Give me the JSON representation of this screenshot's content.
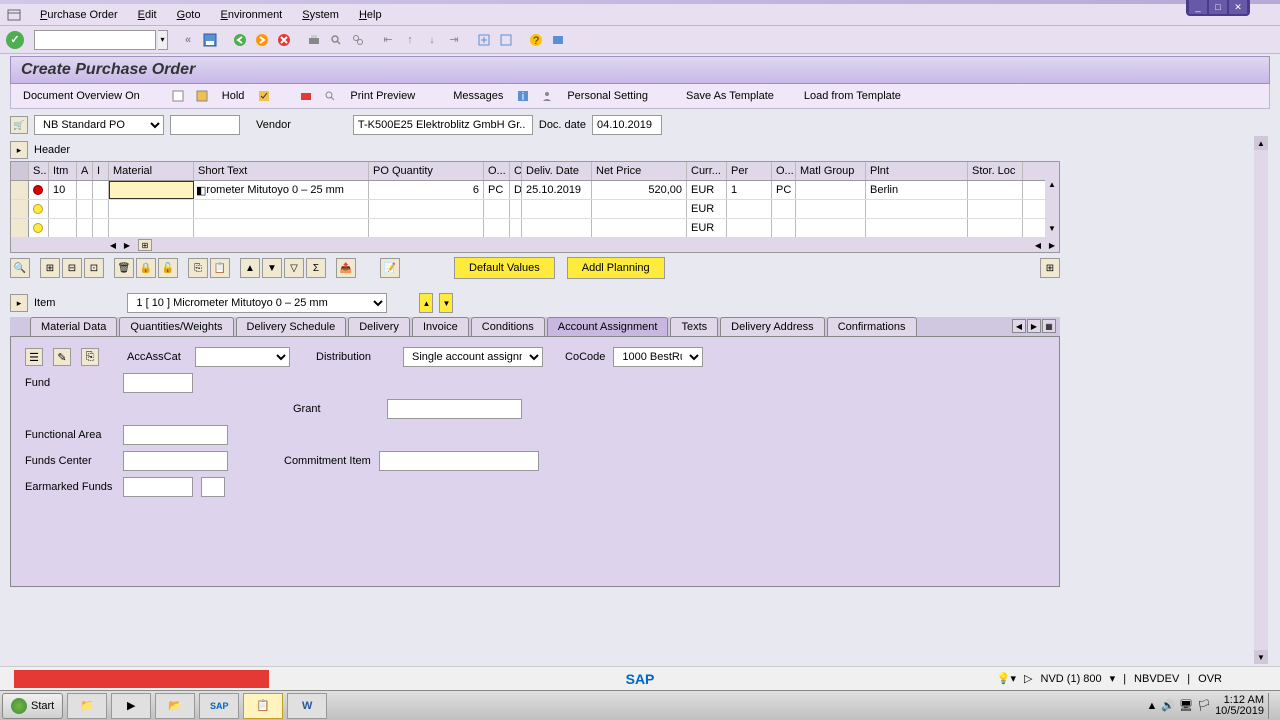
{
  "window": {
    "min": "_",
    "max": "□",
    "close": "✕"
  },
  "menu": {
    "items": [
      "Purchase Order",
      "Edit",
      "Goto",
      "Environment",
      "System",
      "Help"
    ]
  },
  "title": "Create Purchase Order",
  "actions": {
    "doc_overview": "Document Overview On",
    "hold": "Hold",
    "print_preview": "Print Preview",
    "messages": "Messages",
    "personal_setting": "Personal Setting",
    "save_template": "Save As Template",
    "load_template": "Load from Template"
  },
  "header": {
    "po_type": "NB Standard PO",
    "vendor_label": "Vendor",
    "vendor_value": "T-K500E25 Elektroblitz GmbH Gr..",
    "doc_date_label": "Doc. date",
    "doc_date_value": "04.10.2019",
    "header_label": "Header"
  },
  "grid": {
    "cols": [
      "S..",
      "Itm",
      "A",
      "I",
      "Material",
      "Short Text",
      "PO Quantity",
      "O...",
      "C",
      "Deliv. Date",
      "Net Price",
      "Curr...",
      "Per",
      "O...",
      "Matl Group",
      "Plnt",
      "Stor. Loc"
    ],
    "rows": [
      {
        "status": "red",
        "itm": "10",
        "a": "",
        "i": "",
        "material": "",
        "short_text": "rometer Mitutoyo 0 – 25 mm",
        "qty": "6",
        "unit": "PC",
        "c": "D",
        "deliv": "25.10.2019",
        "price": "520,00",
        "curr": "EUR",
        "per": "1",
        "ounit": "PC",
        "matl": "",
        "plnt": "Berlin"
      },
      {
        "status": "yellow",
        "curr": "EUR"
      },
      {
        "status": "yellow",
        "curr": "EUR"
      }
    ]
  },
  "grid_actions": {
    "default_values": "Default Values",
    "addl_planning": "Addl Planning"
  },
  "item": {
    "label": "Item",
    "selected": "1 [ 10 ] Micrometer Mitutoyo 0 – 25 mm"
  },
  "tabs": [
    "Material Data",
    "Quantities/Weights",
    "Delivery Schedule",
    "Delivery",
    "Invoice",
    "Conditions",
    "Account Assignment",
    "Texts",
    "Delivery Address",
    "Confirmations"
  ],
  "active_tab": 6,
  "acct": {
    "accasscat_label": "AccAssCat",
    "distribution_label": "Distribution",
    "distribution_value": "Single account assignm..",
    "cocode_label": "CoCode",
    "cocode_value": "1000 BestRu..",
    "fund_label": "Fund",
    "grant_label": "Grant",
    "funcarea_label": "Functional Area",
    "fundscenter_label": "Funds Center",
    "commitment_label": "Commitment Item",
    "earmarked_label": "Earmarked Funds"
  },
  "status": {
    "sap": "SAP",
    "client": "NVD (1) 800",
    "server": "NBVDEV",
    "mode": "OVR"
  },
  "taskbar": {
    "start": "Start",
    "time": "1:12 AM",
    "date": "10/5/2019"
  }
}
